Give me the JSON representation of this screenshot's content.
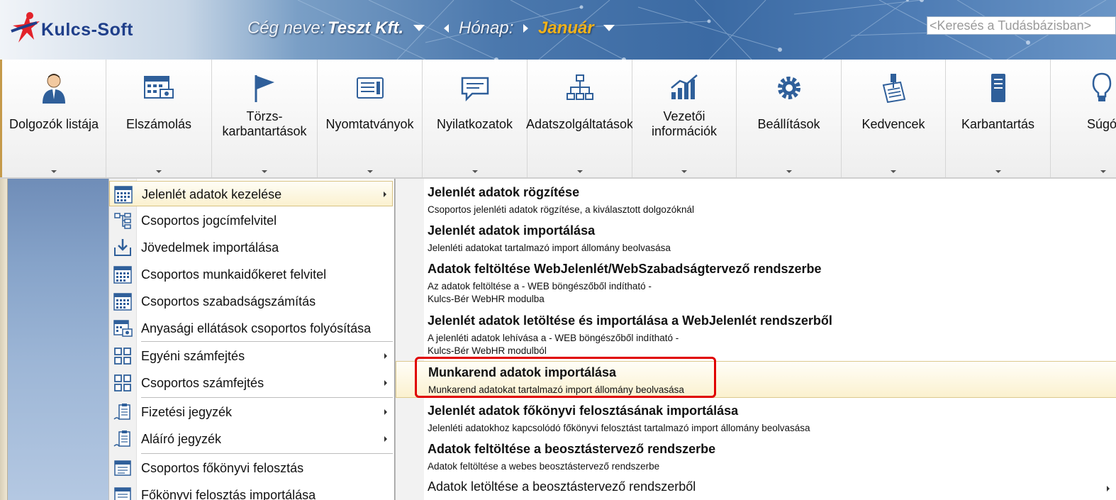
{
  "header": {
    "logo_text": "Kulcs-Soft",
    "company_label": "Cég neve:",
    "company_value": "Teszt Kft.",
    "month_label": "Hónap:",
    "month_value": "Január",
    "search_placeholder": "<Keresés a Tudásbázisban>",
    "accent_month_color": "#f0b21b"
  },
  "ribbon": {
    "buttons": [
      {
        "label": "Dolgozók listája",
        "icon": "employee-icon"
      },
      {
        "label": "Elszámolás",
        "icon": "calendar-icon"
      },
      {
        "label": "Törzs-\nkarbantartások",
        "icon": "flag-icon"
      },
      {
        "label": "Nyomtatványok",
        "icon": "document-icon"
      },
      {
        "label": "Nyilatkozatok",
        "icon": "speech-bubble-icon"
      },
      {
        "label": "Adatszolgáltatások",
        "icon": "org-chart-icon"
      },
      {
        "label": "Vezetői\ninformációk",
        "icon": "bar-chart-icon"
      },
      {
        "label": "Beállítások",
        "icon": "gear-icon"
      },
      {
        "label": "Kedvencek",
        "icon": "pinned-note-icon"
      },
      {
        "label": "Karbantartás",
        "icon": "server-icon"
      },
      {
        "label": "Súgó",
        "icon": "lightbulb-icon"
      }
    ]
  },
  "menu1": {
    "items": [
      {
        "label": "Jelenlét adatok kezelése",
        "icon": "calendar-grid-icon",
        "submenu": true
      },
      {
        "label": "Csoportos jogcímfelvitel",
        "icon": "tree-icon",
        "submenu": false
      },
      {
        "label": "Jövedelmek importálása",
        "icon": "import-tray-icon",
        "submenu": false
      },
      {
        "label": "Csoportos munkaidőkeret felvitel",
        "icon": "calendar-grid-icon",
        "submenu": false
      },
      {
        "label": "Csoportos szabadságszámítás",
        "icon": "calendar-grid-icon",
        "submenu": false
      },
      {
        "label": "Anyasági ellátások csoportos folyósítása",
        "icon": "calendar-money-icon",
        "submenu": false
      },
      {
        "label": "Egyéni számfejtés",
        "icon": "grid-squares-icon",
        "submenu": true
      },
      {
        "label": "Csoportos számfejtés",
        "icon": "grid-squares-icon",
        "submenu": true
      },
      {
        "label": "Fizetési jegyzék",
        "icon": "clipboard-pen-icon",
        "submenu": true
      },
      {
        "label": "Aláíró jegyzék",
        "icon": "clipboard-pen-icon",
        "submenu": true
      },
      {
        "label": "Csoportos főkönyvi felosztás",
        "icon": "ledger-icon",
        "submenu": false
      },
      {
        "label": "Főkönyvi felosztás importálása",
        "icon": "ledger-icon",
        "submenu": false
      }
    ]
  },
  "menu2": {
    "items": [
      {
        "title": "Jelenlét adatok rögzítése",
        "desc": [
          "Csoportos jelenléti adatok rögzítése, a kiválasztott dolgozóknál"
        ]
      },
      {
        "title": "Jelenlét adatok importálása",
        "desc": [
          "Jelenléti adatokat tartalmazó import állomány beolvasása"
        ]
      },
      {
        "title": "Adatok feltöltése WebJelenlét/WebSzabadságtervező rendszerbe",
        "desc": [
          "Az adatok feltöltése a - WEB böngészőből indítható -",
          "Kulcs-Bér WebHR modulba"
        ]
      },
      {
        "title": "Jelenlét adatok letöltése és importálása a WebJelenlét rendszerből",
        "desc": [
          "A jelenléti adatok lehívása a - WEB böngészőből indítható -",
          "Kulcs-Bér WebHR modulból"
        ]
      },
      {
        "title": "Munkarend adatok importálása",
        "desc": [
          "Munkarend adatokat tartalmazó import állomány beolvasása"
        ]
      },
      {
        "title": "Jelenlét adatok főkönyvi felosztásának importálása",
        "desc": [
          "Jelenléti adatokhoz kapcsolódó főkönyvi felosztást tartalmazó import állomány beolvasása"
        ]
      },
      {
        "title": "Adatok feltöltése a beosztástervező rendszerbe",
        "desc": [
          "Adatok feltöltése a webes beosztástervező rendszerbe"
        ]
      },
      {
        "plain": "Adatok letöltése a beosztástervező rendszerből"
      }
    ]
  }
}
